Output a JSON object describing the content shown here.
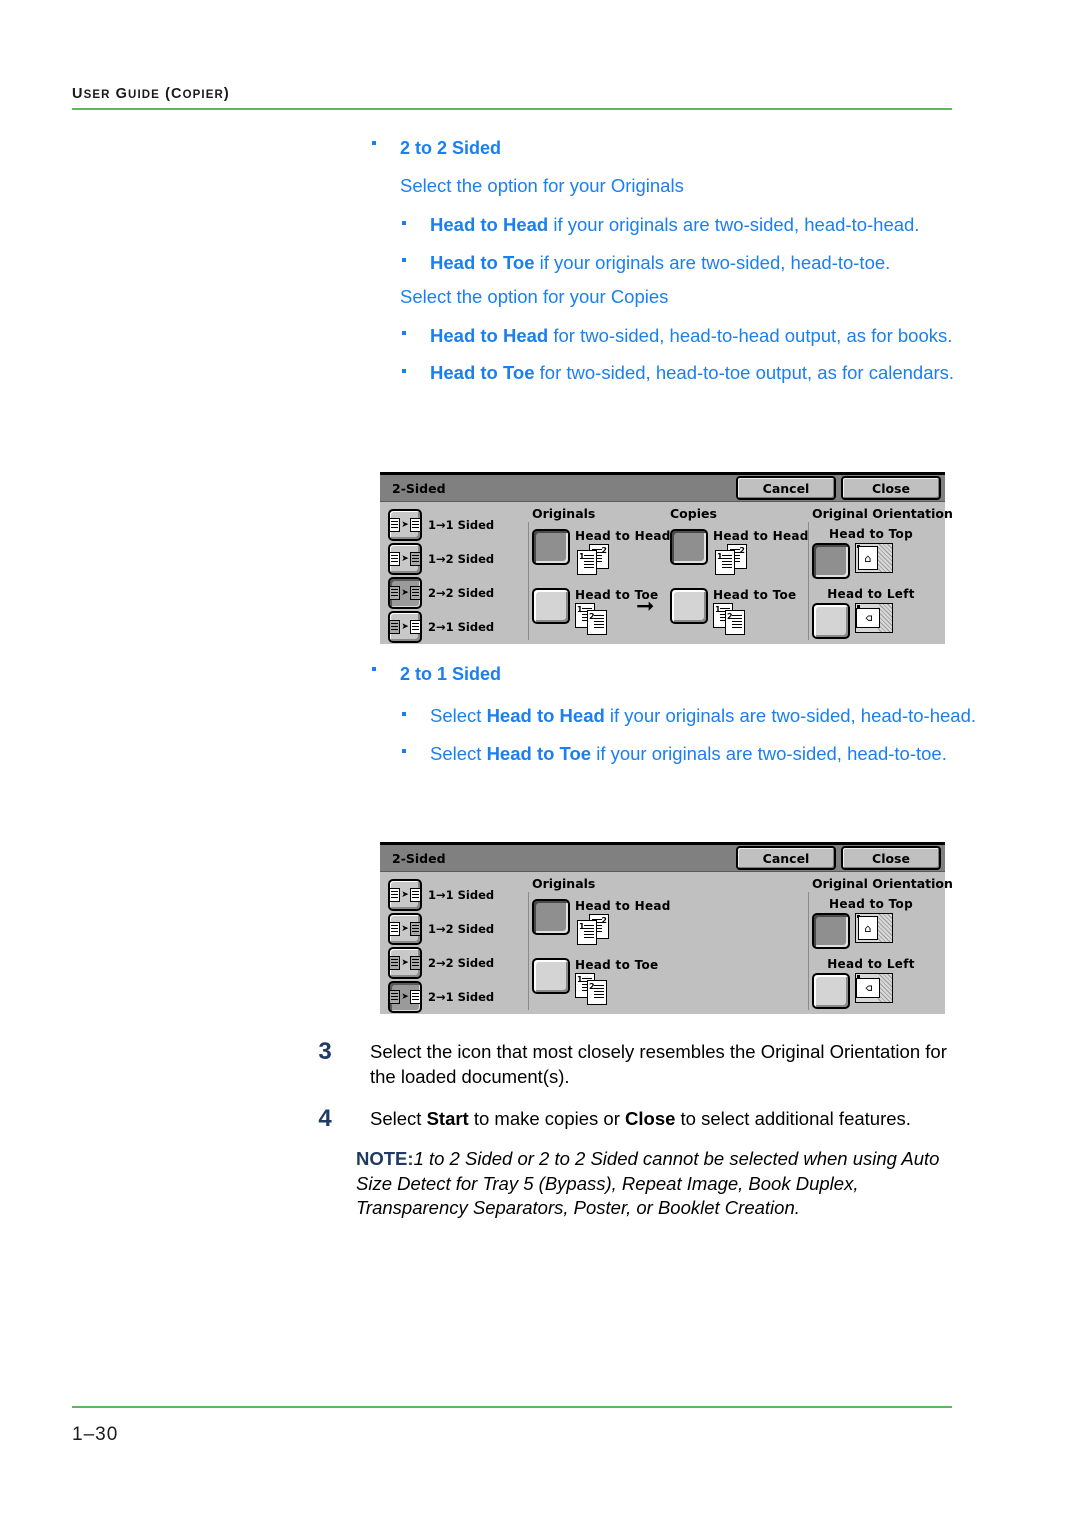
{
  "header": {
    "running_head": "USER GUIDE (COPIER)",
    "rule_color": "#5cb85c"
  },
  "colors": {
    "body_blue": "#1a7ff0",
    "step_navy": "#1f3a63",
    "rule_green": "#5cb85c",
    "panel_face": "#c0c0c0",
    "panel_titlebar": "#808080"
  },
  "sections": [
    {
      "heading": "2 to 2 Sided",
      "intro_originals": "Select the option for your Originals",
      "originals_items": [
        {
          "bold": "Head to Head",
          "rest": " if your originals are two-sided, head-to-head."
        },
        {
          "bold": "Head to Toe",
          "rest": " if your originals are two-sided, head-to-toe."
        }
      ],
      "intro_copies": "Select the option for your Copies",
      "copies_items": [
        {
          "bold": "Head to Head",
          "rest": " for two-sided, head-to-head output, as for books."
        },
        {
          "bold": "Head to Toe",
          "rest": " for two-sided, head-to-toe output, as for calendars."
        }
      ]
    },
    {
      "heading": "2 to 1 Sided",
      "items": [
        {
          "pre": "Select ",
          "bold": "Head to Head",
          "rest": " if your originals are two-sided, head-to-head."
        },
        {
          "pre": "Select ",
          "bold": "Head to Toe",
          "rest": " if your originals are two-sided, head-to-toe."
        }
      ]
    }
  ],
  "panel1": {
    "title": "2-Sided",
    "cancel_label": "Cancel",
    "close_label": "Close",
    "modes": [
      {
        "label": "1→1 Sided",
        "selected": false
      },
      {
        "label": "1→2 Sided",
        "selected": false
      },
      {
        "label": "2→2 Sided",
        "selected": true
      },
      {
        "label": "2→1 Sided",
        "selected": false
      }
    ],
    "originals": {
      "title": "Originals",
      "options": [
        {
          "label": "Head to Head",
          "selected": true
        },
        {
          "label": "Head to Toe",
          "selected": false
        }
      ]
    },
    "copies": {
      "title": "Copies",
      "options": [
        {
          "label": "Head to Head",
          "selected": true
        },
        {
          "label": "Head to Toe",
          "selected": false
        }
      ]
    },
    "orientation": {
      "title": "Original Orientation",
      "options": [
        {
          "label": "Head to Top",
          "selected": true
        },
        {
          "label": "Head to Left",
          "selected": false
        }
      ]
    }
  },
  "panel2": {
    "title": "2-Sided",
    "cancel_label": "Cancel",
    "close_label": "Close",
    "modes": [
      {
        "label": "1→1 Sided",
        "selected": false
      },
      {
        "label": "1→2 Sided",
        "selected": false
      },
      {
        "label": "2→2 Sided",
        "selected": false
      },
      {
        "label": "2→1 Sided",
        "selected": true
      }
    ],
    "originals": {
      "title": "Originals",
      "options": [
        {
          "label": "Head to Head",
          "selected": true
        },
        {
          "label": "Head to Toe",
          "selected": false
        }
      ]
    },
    "orientation": {
      "title": "Original Orientation",
      "options": [
        {
          "label": "Head to Top",
          "selected": true
        },
        {
          "label": "Head to Left",
          "selected": false
        }
      ]
    }
  },
  "steps": [
    {
      "number": "3",
      "text": "Select the icon that most closely resembles the Original Orientation for the loaded document(s)."
    },
    {
      "number": "4",
      "pre": "Select ",
      "bold1": "Start",
      "mid": " to make copies or ",
      "bold2": "Close",
      "post": " to select additional features."
    }
  ],
  "note": {
    "label": "NOTE:",
    "text": "1 to 2 Sided or 2 to 2 Sided cannot be selected when using Auto Size Detect for Tray 5 (Bypass), Repeat Image, Book Duplex, Transparency Separators, Poster, or Booklet Creation."
  },
  "footer": {
    "folio": "1–30"
  }
}
